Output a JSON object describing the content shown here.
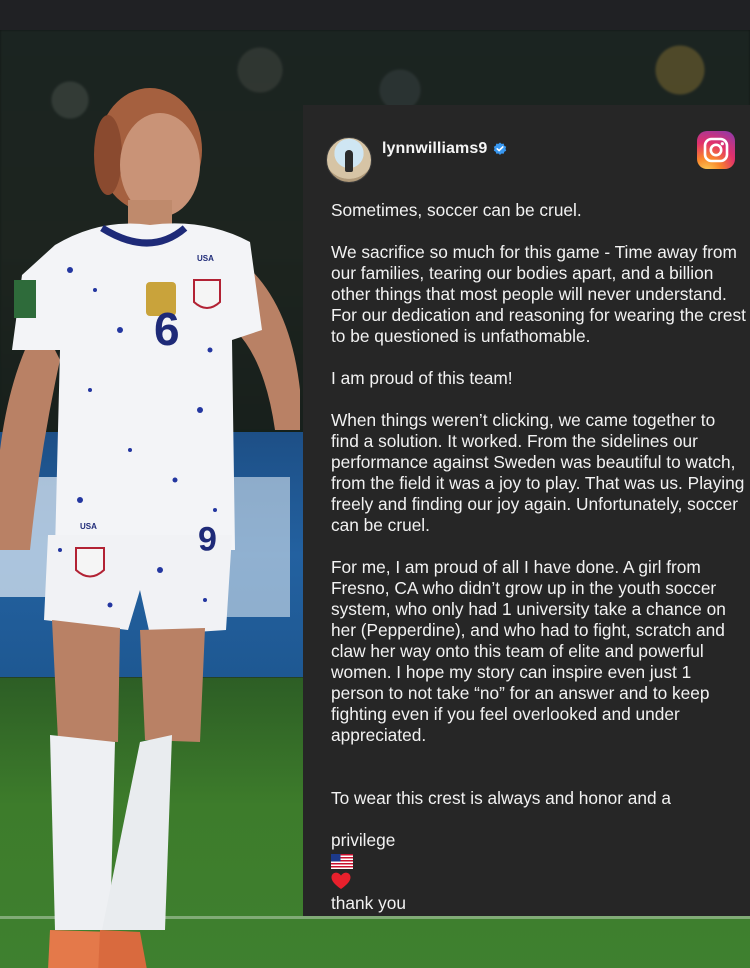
{
  "post": {
    "username": "lynnwilliams9",
    "paragraphs": [
      "Sometimes, soccer can be cruel.",
      "We sacrifice so much for this game - Time away from our families, tearing our bodies apart, and a billion other things that most people will never understand. For our dedication and reasoning for wearing the crest to be questioned is unfathomable.",
      "I am proud of this team!",
      "When things weren’t clicking, we came together to find a solution. It worked. From the sidelines our performance against Sweden was beautiful to watch, from the field it was a joy to play. That was us. Playing freely and finding our joy again. Unfortunately, soccer can be cruel.",
      "For me, I am proud of all I have done. A girl from Fresno, CA who didn’t grow up in the youth soccer system, who only had 1 university take a chance on her (Pepperdine), and who had to fight, scratch and claw her way onto this team of elite and powerful women. I hope my story can inspire even just 1 person to not take “no” for an answer and to keep fighting even if you feel overlooked and under appreciated."
    ],
    "closing_part1": "To wear this crest is always and honor and a",
    "closing_part2": "privilege",
    "closing_part3": "thank you"
  },
  "jersey": {
    "number": "6",
    "crest_text": "USA"
  },
  "icons": {
    "verified": "verified-badge-icon",
    "instagram": "instagram-logo-icon",
    "flag": "us-flag-emoji",
    "heart": "red-heart-emoji"
  },
  "colors": {
    "card_bg": "#262626",
    "verified_blue": "#3897f0",
    "text": "#f2f2f2"
  }
}
